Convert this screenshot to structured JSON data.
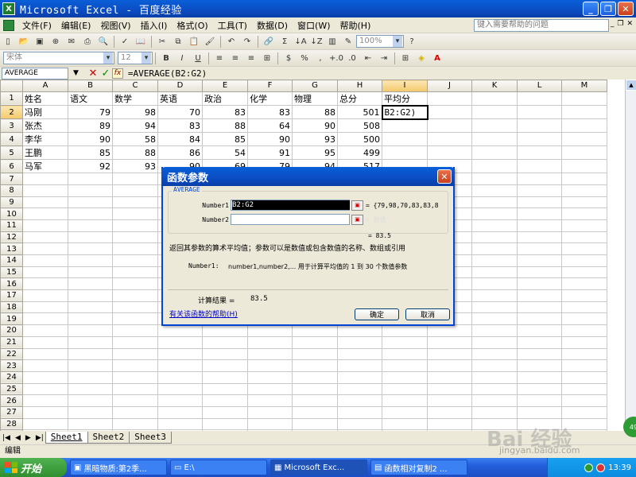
{
  "window": {
    "title": "Microsoft Excel - 百度经验",
    "app_icon_letter": "X",
    "buttons": [
      "_",
      "❐",
      "✕"
    ]
  },
  "menubar": {
    "items": [
      "文件(F)",
      "编辑(E)",
      "视图(V)",
      "插入(I)",
      "格式(O)",
      "工具(T)",
      "数据(D)",
      "窗口(W)",
      "帮助(H)"
    ],
    "help_placeholder": "键入需要帮助的问题"
  },
  "toolbar": {
    "zoom": "100%",
    "font_name": "宋体",
    "font_size": "12",
    "bold": "B",
    "italic": "I",
    "underline": "U"
  },
  "formula_bar": {
    "name_box": "AVERAGE",
    "cancel": "✕",
    "enter": "✓",
    "fx": "fx",
    "formula": "=AVERAGE(B2:G2)"
  },
  "sheet": {
    "columns": [
      "A",
      "B",
      "C",
      "D",
      "E",
      "F",
      "G",
      "H",
      "I",
      "J",
      "K",
      "L",
      "M"
    ],
    "header_row": [
      "姓名",
      "语文",
      "数学",
      "英语",
      "政治",
      "化学",
      "物理",
      "总分",
      "平均分"
    ],
    "rows": [
      [
        "冯刚",
        "79",
        "98",
        "70",
        "83",
        "83",
        "88",
        "501",
        "B2:G2)"
      ],
      [
        "张杰",
        "89",
        "94",
        "83",
        "88",
        "64",
        "90",
        "508",
        ""
      ],
      [
        "李华",
        "90",
        "58",
        "84",
        "85",
        "90",
        "93",
        "500",
        ""
      ],
      [
        "王鹏",
        "85",
        "88",
        "86",
        "54",
        "91",
        "95",
        "499",
        ""
      ],
      [
        "马军",
        "92",
        "93",
        "90",
        "69",
        "79",
        "94",
        "517",
        ""
      ]
    ],
    "total_rows": 29
  },
  "tabs": [
    "Sheet1",
    "Sheet2",
    "Sheet3"
  ],
  "status": "编辑",
  "dialog": {
    "title": "函数参数",
    "function_name": "AVERAGE",
    "number1_label": "Number1",
    "number1_value": "B2:G2",
    "number1_result": "= {79,98,70,83,83,8",
    "number2_label": "Number2",
    "number2_result": "= 数值",
    "result_value": "= 83.5",
    "description": "返回其参数的算术平均值；参数可以是数值或包含数值的名称、数组或引用",
    "arg_help_label": "Number1:",
    "arg_help_text": "number1,number2,... 用于计算平均值的 1 到 30 个数值参数",
    "calc_label": "计算结果 =",
    "calc_value": "83.5",
    "help_link": "有关该函数的帮助(H)",
    "ok": "确定",
    "cancel": "取消"
  },
  "taskbar": {
    "start": "开始",
    "items": [
      "黑暗物质:第2季...",
      "E:\\",
      "Microsoft Exc...",
      "函数相对复制2 ..."
    ],
    "time": "13:39"
  },
  "watermark": {
    "brand": "Bai 经验",
    "url": "jingyan.baidu.com"
  }
}
